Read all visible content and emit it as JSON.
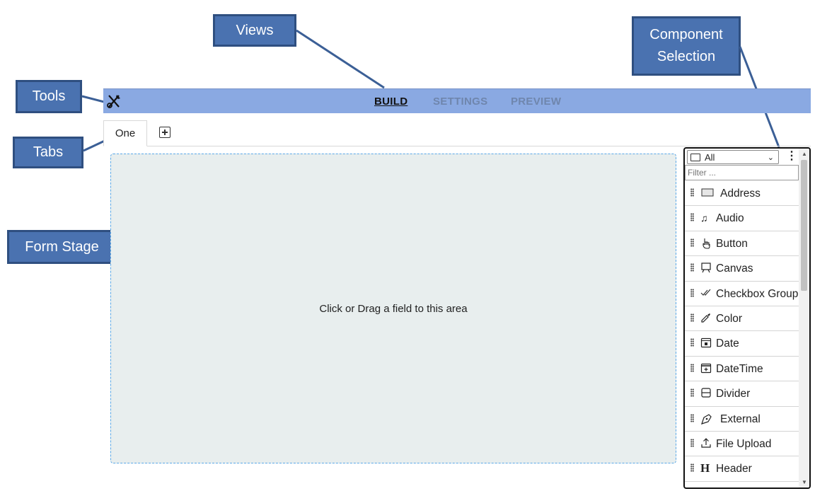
{
  "callouts": {
    "views": "Views",
    "component_selection": "Component Selection",
    "tools": "Tools",
    "tabs": "Tabs",
    "form_stage": "Form Stage"
  },
  "toolbar": {
    "tools_icon": "tools-icon",
    "views": [
      {
        "label": "BUILD",
        "active": true
      },
      {
        "label": "SETTINGS",
        "active": false
      },
      {
        "label": "PREVIEW",
        "active": false
      }
    ]
  },
  "tabs": {
    "items": [
      {
        "label": "One"
      }
    ],
    "add_icon": "plus-box-icon"
  },
  "stage": {
    "hint": "Click or Drag a field to this area"
  },
  "component_panel": {
    "category_select": {
      "selected": "All"
    },
    "menu_icon": "kebab-icon",
    "filter": {
      "placeholder": "Filter ...",
      "value": ""
    },
    "components": [
      {
        "label": "Address",
        "icon": "address-card-icon"
      },
      {
        "label": "Audio",
        "icon": "music-note-icon"
      },
      {
        "label": "Button",
        "icon": "pointer-hand-icon"
      },
      {
        "label": "Canvas",
        "icon": "easel-icon"
      },
      {
        "label": "Checkbox Group",
        "icon": "double-check-icon"
      },
      {
        "label": "Color",
        "icon": "eyedropper-icon"
      },
      {
        "label": "Date",
        "icon": "calendar-icon"
      },
      {
        "label": "DateTime",
        "icon": "calendar-plus-icon"
      },
      {
        "label": "Divider",
        "icon": "divider-icon"
      },
      {
        "label": "External",
        "icon": "pen-nib-icon"
      },
      {
        "label": "File Upload",
        "icon": "upload-icon"
      },
      {
        "label": "Header",
        "icon": "header-icon"
      },
      {
        "label": "",
        "icon": "partial-icon"
      }
    ]
  },
  "colors": {
    "callout_fill": "#4a72b0",
    "callout_border": "#2f4f80",
    "topbar": "#8aa9e2",
    "stage_bg": "#e8eeee",
    "stage_border": "#5aa8e8"
  }
}
